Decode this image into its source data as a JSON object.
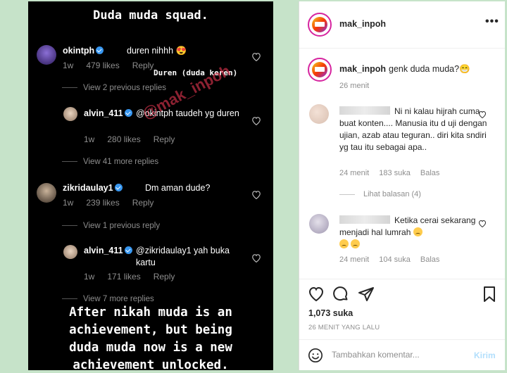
{
  "image": {
    "title": "Duda muda squad.",
    "watermark": "@mak_inpoh",
    "annotation": "Duren (duda keren)",
    "caption_lines": [
      "After nikah muda is an",
      "achievement, but being",
      "duda muda now is a new",
      "achievement unlocked."
    ],
    "comments": [
      {
        "name": "okintph",
        "text": "duren nihhh 😍",
        "time": "1w",
        "likes": "479 likes",
        "reply": "Reply"
      },
      {
        "name": "alvin_411",
        "text": "@okintph taudeh yg duren",
        "time": "1w",
        "likes": "280 likes",
        "reply": "Reply"
      },
      {
        "name": "zikridaulay1",
        "text": "Dm aman dude?",
        "time": "1w",
        "likes": "239 likes",
        "reply": "Reply"
      },
      {
        "name": "alvin_411",
        "text": "@zikridaulay1 yah buka kartu",
        "time": "1w",
        "likes": "171 likes",
        "reply": "Reply"
      }
    ],
    "views": [
      "View 2 previous replies",
      "View 41 more replies",
      "View 1 previous reply",
      "View 7 more replies"
    ]
  },
  "panel": {
    "username": "mak_inpoh",
    "more_icon": "more-horizontal-icon",
    "caption_user": "mak_inpoh",
    "caption_text": "genk duda muda?😁",
    "caption_time": "26 menit",
    "comments": [
      {
        "text": "Ni ni kalau hijrah cuma buat konten.... Manusia itu d uji dengan ujian, azab atau teguran.. diri kita sndiri yg tau itu sebagai apa..",
        "time": "24 menit",
        "likes": "183 suka",
        "reply": "Balas"
      },
      {
        "text": "Ketika cerai sekarang menjadi hal lumrah",
        "time": "24 menit",
        "likes": "104 suka",
        "reply": "Balas"
      }
    ],
    "view_replies": "Lihat balasan (4)",
    "likes": "1,073 suka",
    "post_time": "26 MENIT YANG LALU",
    "comment_placeholder": "Tambahkan komentar...",
    "send_label": "Kirim"
  },
  "colors": {
    "background": "#c6e3c9",
    "verified": "#3897f0",
    "send_disabled": "#b2dffc"
  }
}
